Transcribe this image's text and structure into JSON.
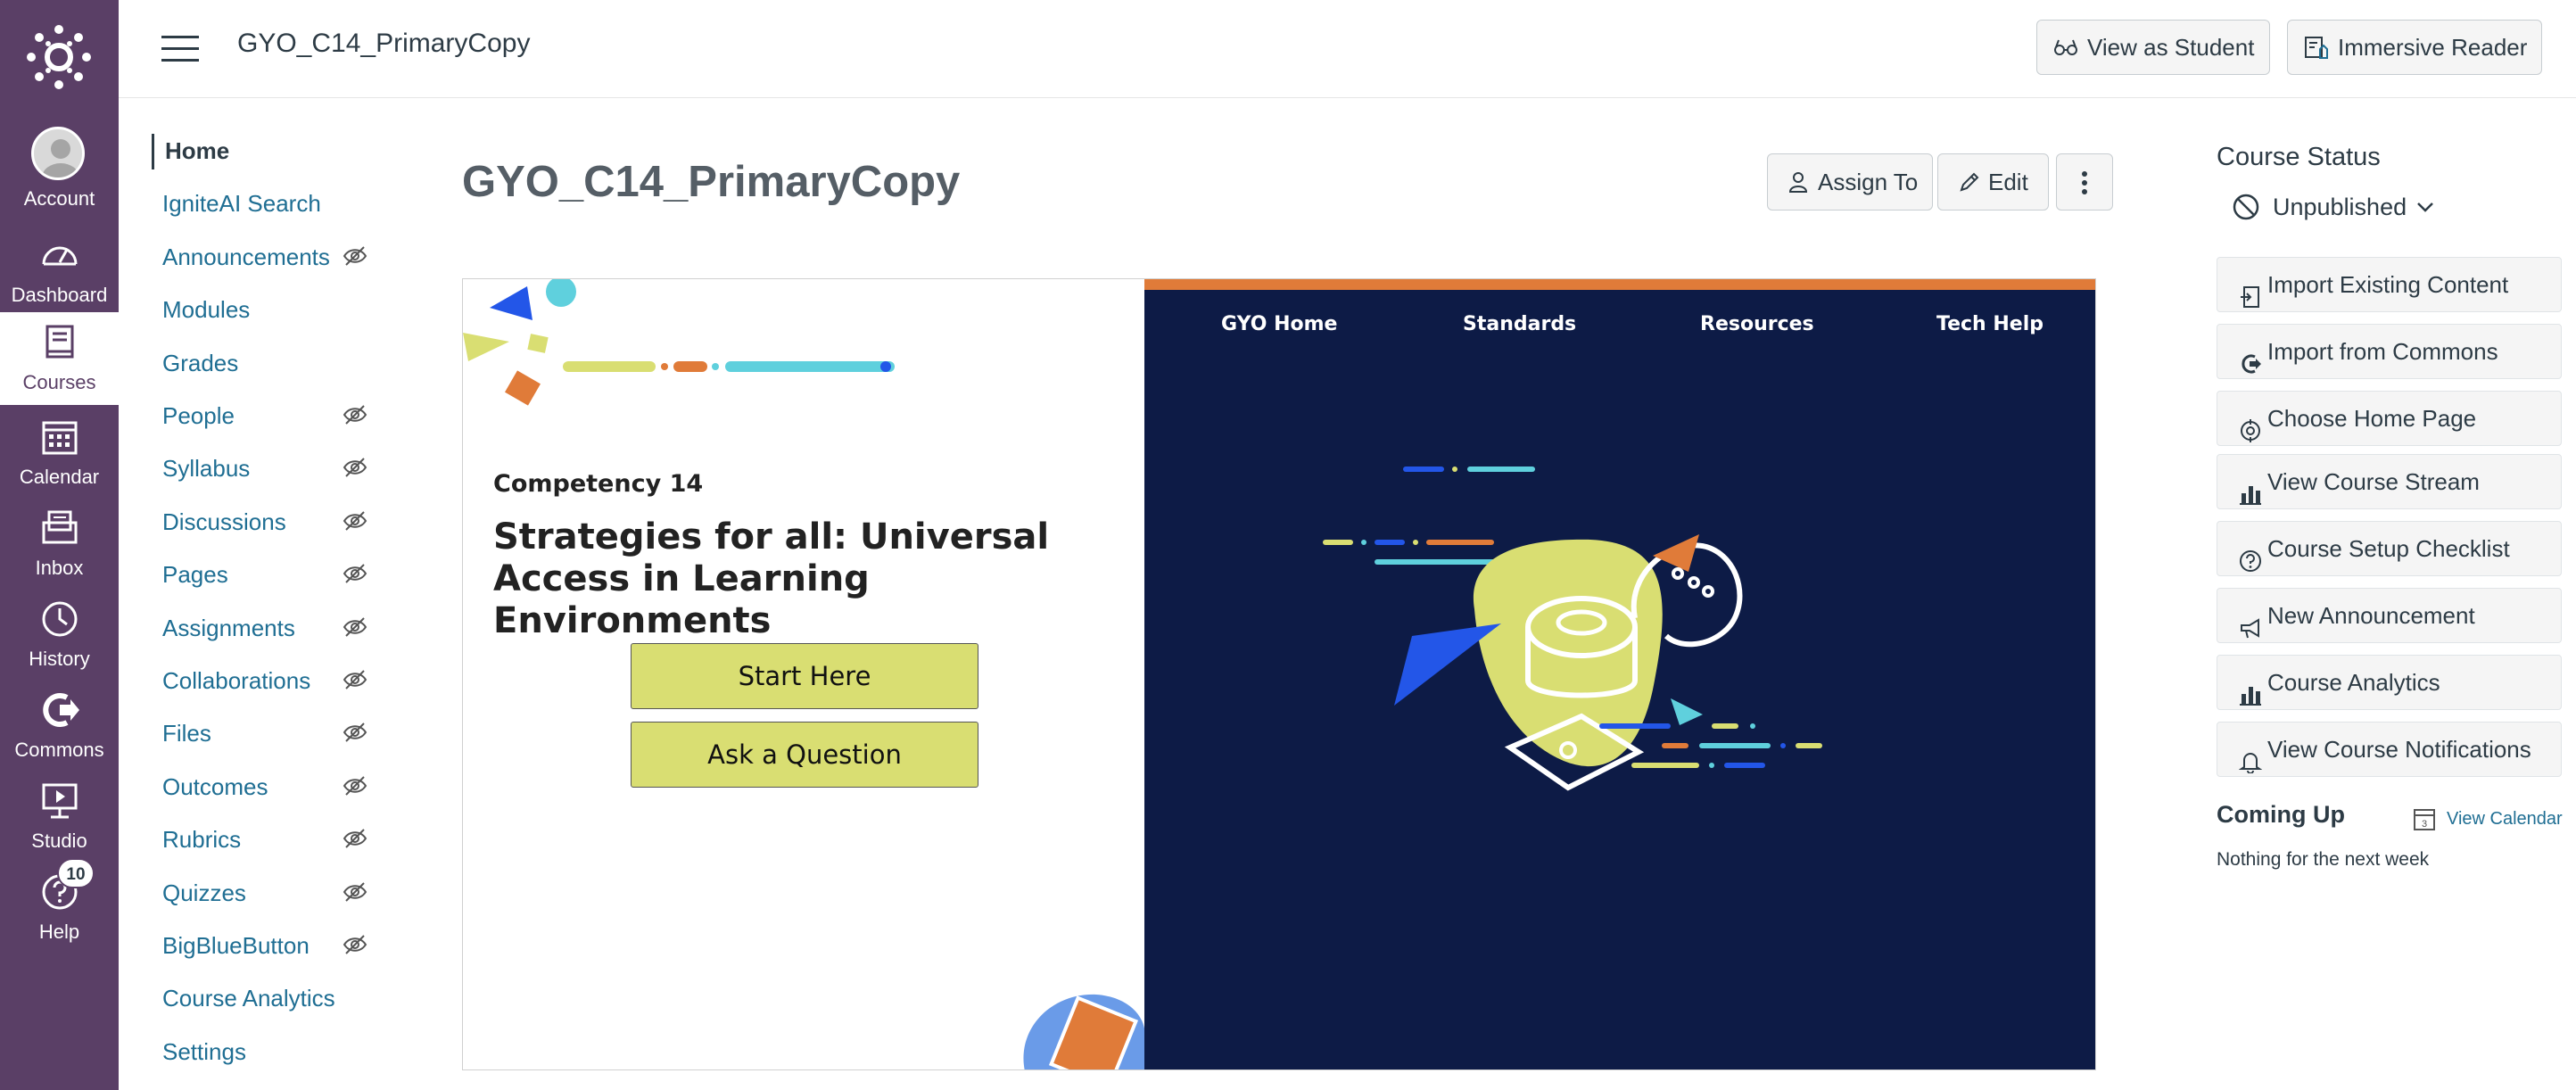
{
  "global_nav": {
    "items": [
      {
        "label": "Account",
        "icon": "account-icon"
      },
      {
        "label": "Dashboard",
        "icon": "dashboard-icon"
      },
      {
        "label": "Courses",
        "icon": "courses-icon"
      },
      {
        "label": "Calendar",
        "icon": "calendar-icon"
      },
      {
        "label": "Inbox",
        "icon": "inbox-icon"
      },
      {
        "label": "History",
        "icon": "history-icon"
      },
      {
        "label": "Commons",
        "icon": "commons-icon"
      },
      {
        "label": "Studio",
        "icon": "studio-icon"
      },
      {
        "label": "Help",
        "icon": "help-icon"
      }
    ],
    "help_badge": "10",
    "active": "Courses"
  },
  "header": {
    "course_title": "GYO_C14_PrimaryCopy",
    "view_as_student": "View as Student",
    "immersive_reader": "Immersive Reader"
  },
  "course_nav": {
    "items": [
      {
        "label": "Home",
        "hidden": false
      },
      {
        "label": "IgniteAI Search",
        "hidden": false
      },
      {
        "label": "Announcements",
        "hidden": true
      },
      {
        "label": "Modules",
        "hidden": false
      },
      {
        "label": "Grades",
        "hidden": false
      },
      {
        "label": "People",
        "hidden": true
      },
      {
        "label": "Syllabus",
        "hidden": true
      },
      {
        "label": "Discussions",
        "hidden": true
      },
      {
        "label": "Pages",
        "hidden": true
      },
      {
        "label": "Assignments",
        "hidden": true
      },
      {
        "label": "Collaborations",
        "hidden": true
      },
      {
        "label": "Files",
        "hidden": true
      },
      {
        "label": "Outcomes",
        "hidden": true
      },
      {
        "label": "Rubrics",
        "hidden": true
      },
      {
        "label": "Quizzes",
        "hidden": true
      },
      {
        "label": "BigBlueButton",
        "hidden": true
      },
      {
        "label": "Course Analytics",
        "hidden": false
      },
      {
        "label": "Settings",
        "hidden": false
      }
    ]
  },
  "main": {
    "heading": "GYO_C14_PrimaryCopy",
    "assign_to": "Assign To",
    "edit": "Edit",
    "banner": {
      "nav": [
        "GYO Home",
        "Standards",
        "Resources",
        "Tech Help"
      ],
      "competency": "Competency 14",
      "headline": "Strategies for all: Universal Access in Learning Environments",
      "start_here": "Start Here",
      "ask_question": "Ask a Question"
    }
  },
  "sidebar": {
    "course_status_title": "Course Status",
    "status": "Unpublished",
    "buttons": [
      {
        "label": "Import Existing Content",
        "icon": "import-icon"
      },
      {
        "label": "Import from Commons",
        "icon": "commons-icon"
      },
      {
        "label": "Choose Home Page",
        "icon": "target-icon"
      },
      {
        "label": "View Course Stream",
        "icon": "bar-chart-icon"
      },
      {
        "label": "Course Setup Checklist",
        "icon": "question-circle-icon"
      },
      {
        "label": "New Announcement",
        "icon": "megaphone-icon"
      },
      {
        "label": "Course Analytics",
        "icon": "bar-chart-icon"
      },
      {
        "label": "View Course Notifications",
        "icon": "bell-icon"
      }
    ],
    "coming_up": "Coming Up",
    "view_calendar": "View Calendar",
    "nothing": "Nothing for the next week"
  },
  "colors": {
    "nav_bg": "#5a3f66",
    "link": "#1f6e93",
    "banner_dark": "#0d1b46",
    "banner_yellow": "#d9de72",
    "banner_orange": "#e07b39"
  }
}
